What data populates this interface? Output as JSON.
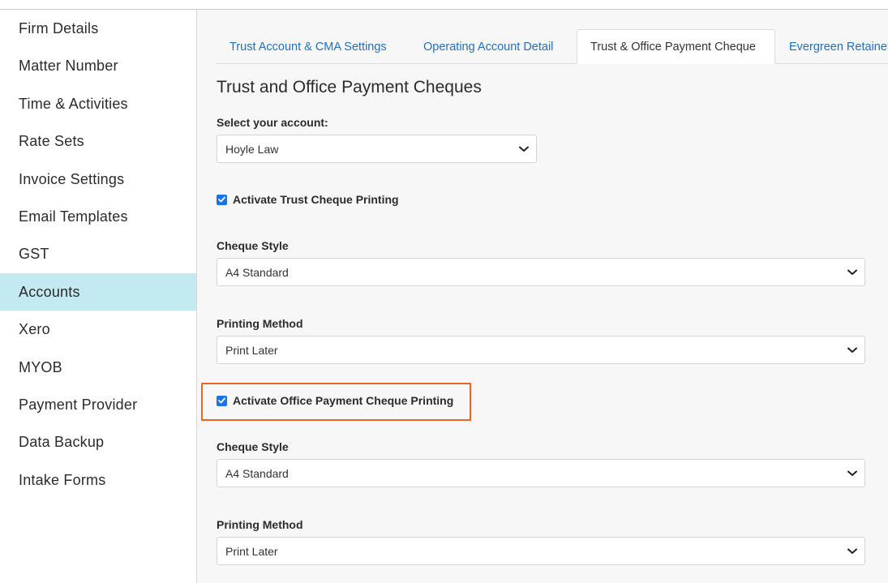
{
  "sidebar": {
    "items": [
      {
        "label": "Firm Details"
      },
      {
        "label": "Matter Number"
      },
      {
        "label": "Time & Activities"
      },
      {
        "label": "Rate Sets"
      },
      {
        "label": "Invoice Settings"
      },
      {
        "label": "Email Templates"
      },
      {
        "label": "GST"
      },
      {
        "label": "Accounts"
      },
      {
        "label": "Xero"
      },
      {
        "label": "MYOB"
      },
      {
        "label": "Payment Provider"
      },
      {
        "label": "Data Backup"
      },
      {
        "label": "Intake Forms"
      }
    ],
    "active": "Accounts"
  },
  "tabs": [
    {
      "label": "Trust Account & CMA Settings"
    },
    {
      "label": "Operating Account Detail"
    },
    {
      "label": "Trust & Office Payment Cheque"
    },
    {
      "label": "Evergreen Retainer"
    }
  ],
  "active_tab": "Trust & Office Payment Cheque",
  "page_title": "Trust and Office Payment Cheques",
  "account": {
    "label": "Select your account:",
    "value": "Hoyle Law"
  },
  "trust": {
    "checkbox_label": "Activate Trust Cheque Printing",
    "checked": true,
    "cheque_style_label": "Cheque Style",
    "cheque_style_value": "A4 Standard",
    "printing_method_label": "Printing Method",
    "printing_method_value": "Print Later"
  },
  "office": {
    "checkbox_label": "Activate Office Payment Cheque Printing",
    "checked": true,
    "cheque_style_label": "Cheque Style",
    "cheque_style_value": "A4 Standard",
    "printing_method_label": "Printing Method",
    "printing_method_value": "Print Later"
  },
  "colors": {
    "accent": "#1f6fc4",
    "active_sidebar": "#c3e9f1",
    "checkbox": "#1a73e8",
    "highlight": "#e8661f"
  }
}
